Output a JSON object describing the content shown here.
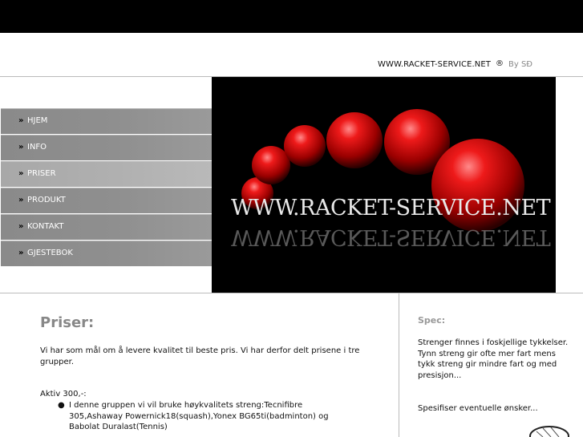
{
  "header": {
    "site_url": "WWW.RACKET-SERVICE.NET",
    "copyright_symbol": "®",
    "by_text": "By SÐ"
  },
  "menu": {
    "bullet": "»",
    "items": [
      {
        "label": "HJEM",
        "active": false
      },
      {
        "label": "INFO",
        "active": false
      },
      {
        "label": "PRISER",
        "active": true
      },
      {
        "label": "PRODUKT",
        "active": false
      },
      {
        "label": "KONTAKT",
        "active": false
      },
      {
        "label": "GJESTEBOK",
        "active": false
      }
    ]
  },
  "hero": {
    "title": "WWW.RACKET-SERVICE.NET",
    "ball_color": "#d40000",
    "background": "#000000"
  },
  "main": {
    "title": "Priser:",
    "intro": "Vi har som mål om å levere kvalitet til beste pris. Vi har derfor delt prisene i tre grupper.",
    "group_label": "Aktiv 300,-:",
    "bullets": [
      "I denne gruppen vi vil bruke høykvalitets streng:Tecnifibre 305,Ashaway Powernick18(squash),Yonex BG65ti(badminton) og Babolat Duralast(Tennis)"
    ]
  },
  "sidebar": {
    "title": "Spec:",
    "text1": "Strenger finnes i foskjellige tykkelser. Tynn streng gir ofte mer fart mens tykk streng gir mindre fart og med presisjon...",
    "text2": "Spesifiser eventuelle ønsker..."
  }
}
